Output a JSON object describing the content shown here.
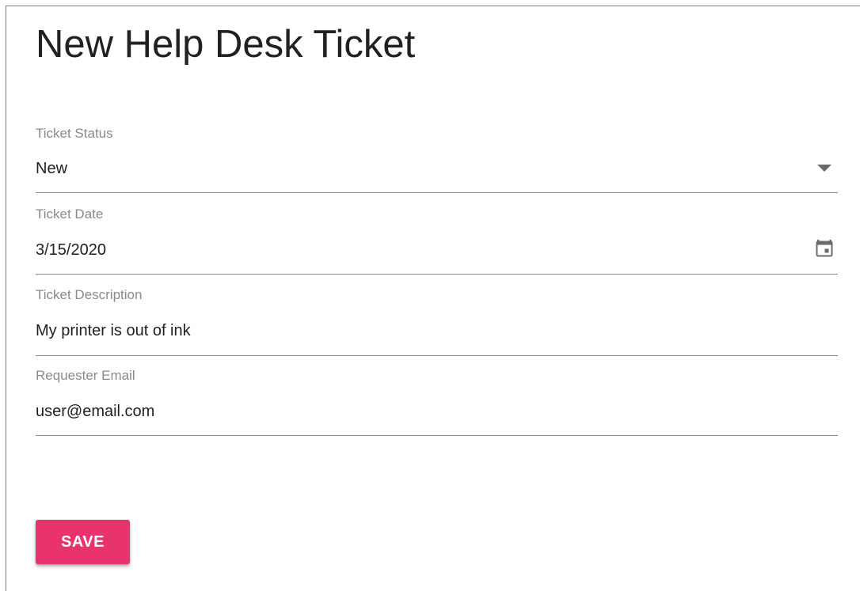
{
  "page": {
    "title": "New Help Desk Ticket"
  },
  "form": {
    "ticket_status": {
      "label": "Ticket Status",
      "value": "New",
      "icon": "dropdown-arrow-icon"
    },
    "ticket_date": {
      "label": "Ticket Date",
      "value": "3/15/2020",
      "icon": "calendar-icon"
    },
    "ticket_description": {
      "label": "Ticket Description",
      "value": "My printer is out of ink"
    },
    "requester_email": {
      "label": "Requester Email",
      "value": "user@email.com"
    }
  },
  "actions": {
    "save_label": "SAVE"
  },
  "colors": {
    "accent": "#e8336d",
    "label": "#8a8a8a",
    "text": "#212121",
    "underline": "#8c8c8c",
    "icon": "#6b6b6b"
  }
}
